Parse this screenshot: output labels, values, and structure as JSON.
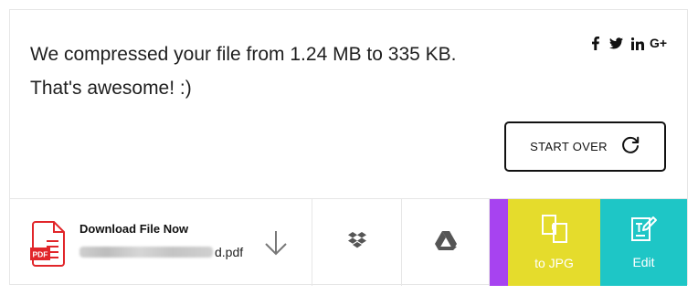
{
  "message": {
    "line1": "We compressed your file from 1.24 MB to 335 KB.",
    "line2": "That's awesome! :)"
  },
  "social": {
    "icons": [
      "facebook-icon",
      "twitter-icon",
      "linkedin-icon",
      "google-plus-icon"
    ],
    "google_plus_text": "G+"
  },
  "actions": {
    "start_over_label": "START OVER"
  },
  "download": {
    "title": "Download File Now",
    "filename_suffix": "d.pdf",
    "file_badge": "PDF"
  },
  "tiles": {
    "to_jpg_label": "to JPG",
    "edit_label": "Edit"
  },
  "colors": {
    "purple": "#a743f0",
    "yellow": "#e5dc2c",
    "teal": "#1ec6c6",
    "pdf_red": "#e1262a"
  }
}
